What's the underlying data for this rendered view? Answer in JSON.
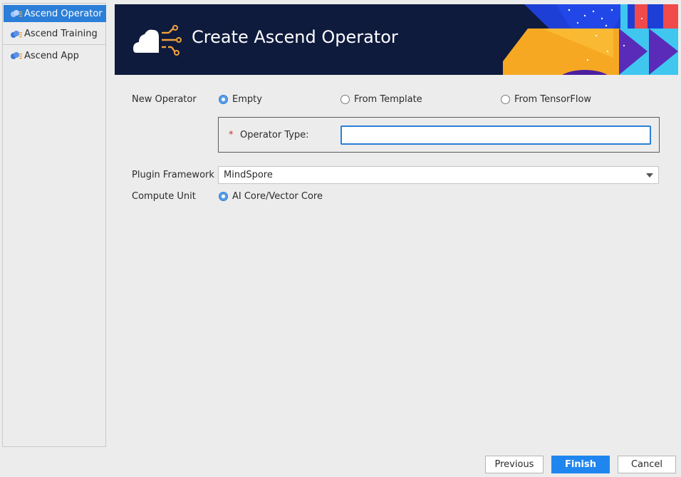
{
  "sidebar": {
    "items": [
      {
        "label": "Ascend Operator",
        "selected": true
      },
      {
        "label": "Ascend Training",
        "selected": false
      },
      {
        "label": "Ascend App",
        "selected": false
      }
    ]
  },
  "banner": {
    "title": "Create Ascend Operator"
  },
  "form": {
    "new_operator_label": "New Operator",
    "options": [
      "Empty",
      "From Template",
      "From TensorFlow"
    ],
    "selected_option": "Empty",
    "operator_type_label": "Operator Type:",
    "operator_type_value": "",
    "plugin_framework_label": "Plugin Framework",
    "plugin_framework_value": "MindSpore",
    "compute_unit_label": "Compute Unit",
    "compute_unit_value": "AI Core/Vector Core",
    "required_marker": "*"
  },
  "buttons": {
    "previous": "Previous",
    "finish": "Finish",
    "cancel": "Cancel"
  },
  "colors": {
    "accent": "#2b7fd8",
    "banner_bg": "#0f1b3d",
    "primary_button": "#1f86ef",
    "required": "#d1312b"
  }
}
